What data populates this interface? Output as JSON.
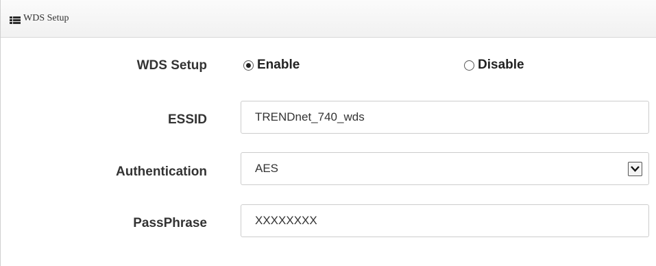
{
  "panel": {
    "title": "WDS Setup",
    "icon": "list-icon"
  },
  "form": {
    "wds_setup": {
      "label": "WDS Setup",
      "options": [
        {
          "label": "Enable",
          "checked": true
        },
        {
          "label": "Disable",
          "checked": false
        }
      ]
    },
    "essid": {
      "label": "ESSID",
      "value": "TRENDnet_740_wds"
    },
    "authentication": {
      "label": "Authentication",
      "selected": "AES",
      "icon": "chevron-down-icon"
    },
    "passphrase": {
      "label": "PassPhrase",
      "value": "XXXXXXXX"
    }
  }
}
